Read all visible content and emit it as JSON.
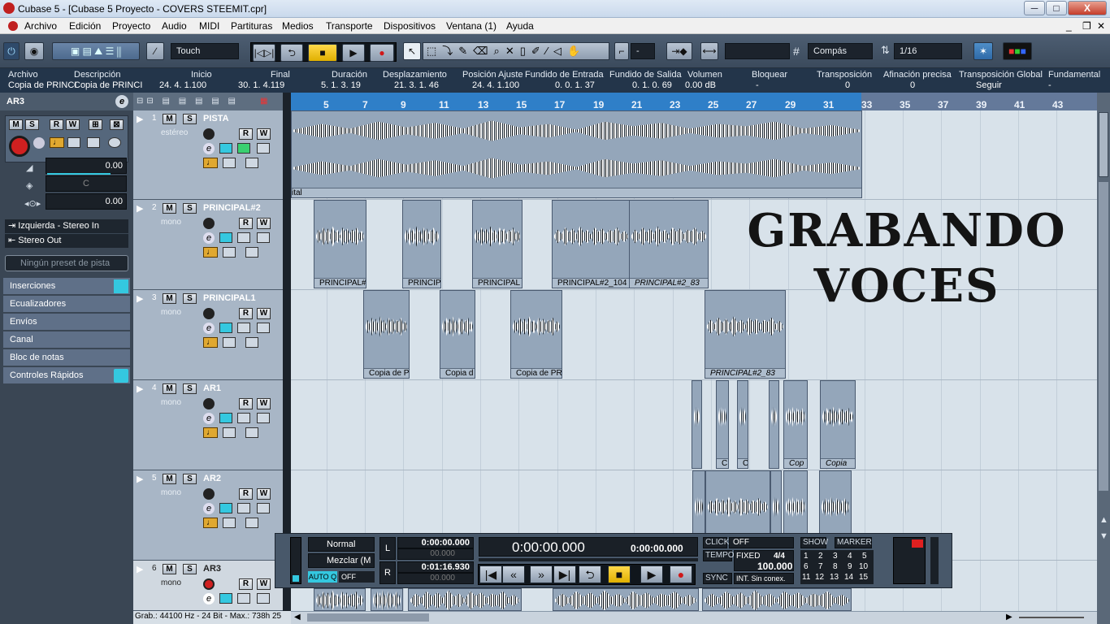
{
  "window": {
    "title": "Cubase 5 - [Cubase 5 Proyecto - COVERS STEEMIT.cpr]",
    "minimize": "─",
    "maximize": "□",
    "close": "X"
  },
  "menu": [
    "Archivo",
    "Edición",
    "Proyecto",
    "Audio",
    "MIDI",
    "Partituras",
    "Medios",
    "Transporte",
    "Dispositivos",
    "Ventana (1)",
    "Ayuda"
  ],
  "toolbar": {
    "automation_mode": "Touch",
    "dash": "-",
    "grid_type": "Compás",
    "quantize": "1/16"
  },
  "infoline": {
    "headers": [
      "Archivo",
      "Descripción",
      "Inicio",
      "Final",
      "Duración",
      "Desplazamiento",
      "Posición Ajuste",
      "Fundido de Entrada",
      "Fundido de Salida",
      "Volumen",
      "Bloquear",
      "Transposición",
      "Afinación precisa",
      "Transposición Global",
      "Fundamental"
    ],
    "values": [
      "Copia de PRINCI",
      "Copia de PRINCI",
      "24. 4. 1.100",
      "30. 1. 4.119",
      "5. 1. 3. 19",
      "21. 3. 1. 46",
      "24. 4. 1.100",
      "0. 0. 1. 37",
      "0. 1. 0. 69",
      "0.00 dB",
      "-",
      "0",
      "0",
      "Seguir",
      "-"
    ]
  },
  "inspector": {
    "track_name": "AR3",
    "fader1": "0.00",
    "pan": "C",
    "fader2": "0.00",
    "input": "Izquierda - Stereo In",
    "output": "Stereo Out",
    "preset_placeholder": "Ningún preset de pista",
    "sections": [
      "Inserciones",
      "Ecualizadores",
      "Envíos",
      "Canal",
      "Bloc de notas",
      "Controles Rápidos"
    ]
  },
  "ruler": [
    "5",
    "7",
    "9",
    "11",
    "13",
    "15",
    "17",
    "19",
    "21",
    "23",
    "25",
    "27",
    "29",
    "31",
    "33",
    "35",
    "37",
    "39",
    "41",
    "43"
  ],
  "tracks": [
    {
      "num": "1",
      "name": "PISTA",
      "sub": "estéreo"
    },
    {
      "num": "2",
      "name": "PRINCIPAL#2",
      "sub": "mono"
    },
    {
      "num": "3",
      "name": "PRINCIPAL1",
      "sub": "mono"
    },
    {
      "num": "4",
      "name": "AR1",
      "sub": "mono"
    },
    {
      "num": "5",
      "name": "AR2",
      "sub": "mono"
    },
    {
      "num": "6",
      "name": "AR3",
      "sub": "mono"
    }
  ],
  "parts": {
    "pista_label": "ital",
    "p2": [
      "PRINCIPAL#",
      "PRINCIP",
      "PRINCIPAL",
      "PRINCIPAL#2_104",
      "PRINCIPAL#2_83"
    ],
    "p3": [
      "Copia de P",
      "Copia d",
      "Copia de PR",
      "PRINCIPAL#2_83"
    ],
    "p4": [
      "C",
      "C",
      "Cop",
      "Copia"
    ]
  },
  "overlay": {
    "line1": "GRABANDO",
    "line2": "VOCES"
  },
  "status": "Grab.: 44100 Hz - 24 Bit - Max.: 738h 25",
  "transport": {
    "mode1": "Normal",
    "mode2": "Mezclar (M",
    "autoq": "AUTO Q",
    "autoq_val": "OFF",
    "left_loc": "0:00:00.000",
    "left_sub": "00.000",
    "right_loc": "0:01:16.930",
    "right_sub": "00.000",
    "main_time": "0:00:00.000",
    "sec_time": "0:00:00.000",
    "click": "CLICK",
    "click_val": "OFF",
    "tempo": "TEMPO",
    "tempo_mode": "FIXED",
    "sig": "4/4",
    "bpm": "100.000",
    "sync": "SYNC",
    "sync_val": "INT. Sin conex.",
    "show": "SHOW",
    "marker": "MARKER",
    "markers": [
      "1",
      "2",
      "3",
      "4",
      "5",
      "6",
      "7",
      "8",
      "9",
      "10",
      "11",
      "12",
      "13",
      "14",
      "15"
    ]
  },
  "colors": {
    "accent": "#34c8e0",
    "record": "#d02020",
    "part": "#94a6ba",
    "ruler": "#64799a"
  }
}
